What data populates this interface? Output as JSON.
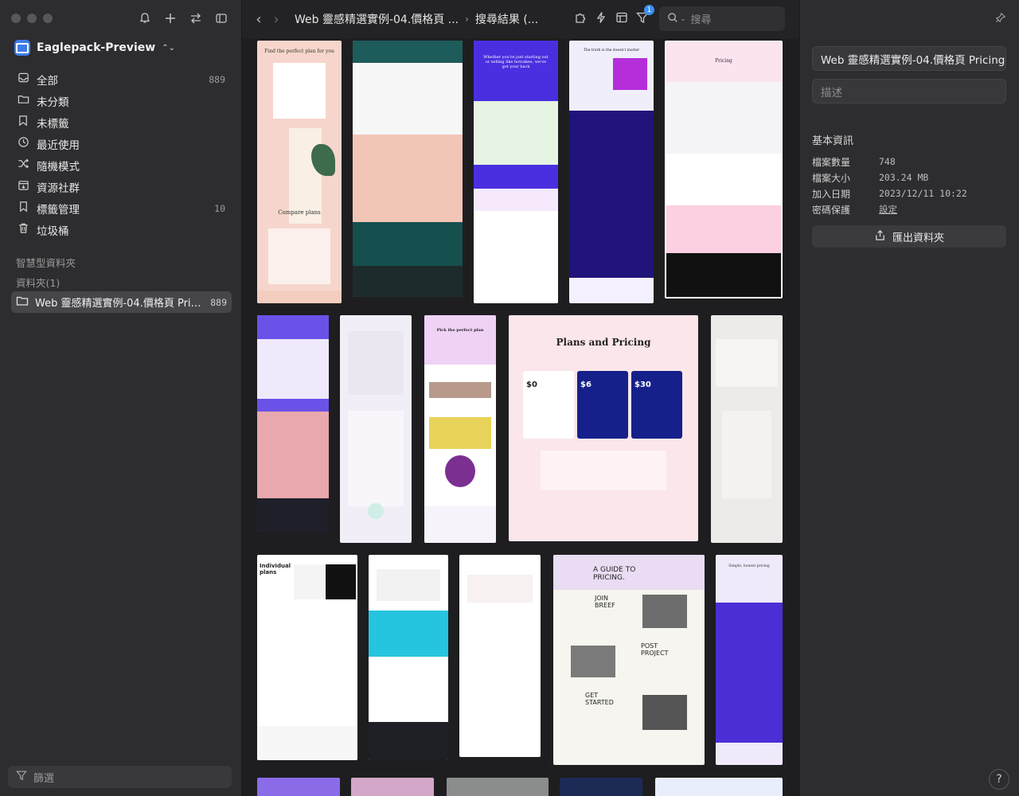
{
  "sidebar": {
    "library_name": "Eaglepack-Preview",
    "items": [
      {
        "label": "全部",
        "count": "889",
        "icon": "inbox-icon"
      },
      {
        "label": "未分類",
        "count": "",
        "icon": "folder-question-icon"
      },
      {
        "label": "未標籤",
        "count": "",
        "icon": "tag-off-icon"
      },
      {
        "label": "最近使用",
        "count": "",
        "icon": "clock-icon"
      },
      {
        "label": "隨機模式",
        "count": "",
        "icon": "shuffle-icon"
      },
      {
        "label": "資源社群",
        "count": "",
        "icon": "download-box-icon"
      },
      {
        "label": "標籤管理",
        "count": "10",
        "icon": "bookmark-icon"
      },
      {
        "label": "垃圾桶",
        "count": "",
        "icon": "trash-icon"
      }
    ],
    "smart_folders_title": "智慧型資料夾",
    "folders_title": "資料夾(1)",
    "folder": {
      "label": "Web 靈感精選實例-04.價格頁 Pric...",
      "count": "889"
    },
    "filter_placeholder": "篩選"
  },
  "toolbar": {
    "breadcrumb_1": "Web 靈感精選實例-04.價格頁 ...",
    "breadcrumb_2": "搜尋結果 (...",
    "filter_badge": "1",
    "search_placeholder": "搜尋"
  },
  "inspector": {
    "name_value": "Web 靈感精選實例-04.價格頁 Pricing",
    "description_placeholder": "描述",
    "info_title": "基本資訊",
    "rows": [
      {
        "key": "檔案數量",
        "value": "748"
      },
      {
        "key": "檔案大小",
        "value": "203.24 MB"
      },
      {
        "key": "加入日期",
        "value": "2023/12/11 10:22"
      },
      {
        "key": "密碼保護",
        "value": "設定"
      }
    ],
    "export_label": "匯出資料夾",
    "help_label": "?"
  },
  "thumbnails": {
    "t1_title": "Find the perfect plan for you",
    "t1_title2": "Compare plans",
    "t3_title": "Whether you're just starting out or selling like hotcakes, we've got your back",
    "t4_title": "The truth is the doesn't matter",
    "t5_title": "Pricing",
    "t8_title": "Pick the perfect plan",
    "t9_title": "Plans and Pricing",
    "t9_price1": "$0",
    "t9_price2": "$6",
    "t9_price3": "$30",
    "t11_title": "Individual plans",
    "t14_title": "A GUIDE TO PRICING.",
    "t14_sub1": "JOIN BREEF",
    "t14_sub2": "POST PROJECT",
    "t14_sub3": "GET STARTED",
    "t15_title": "Simple, honest pricing"
  }
}
